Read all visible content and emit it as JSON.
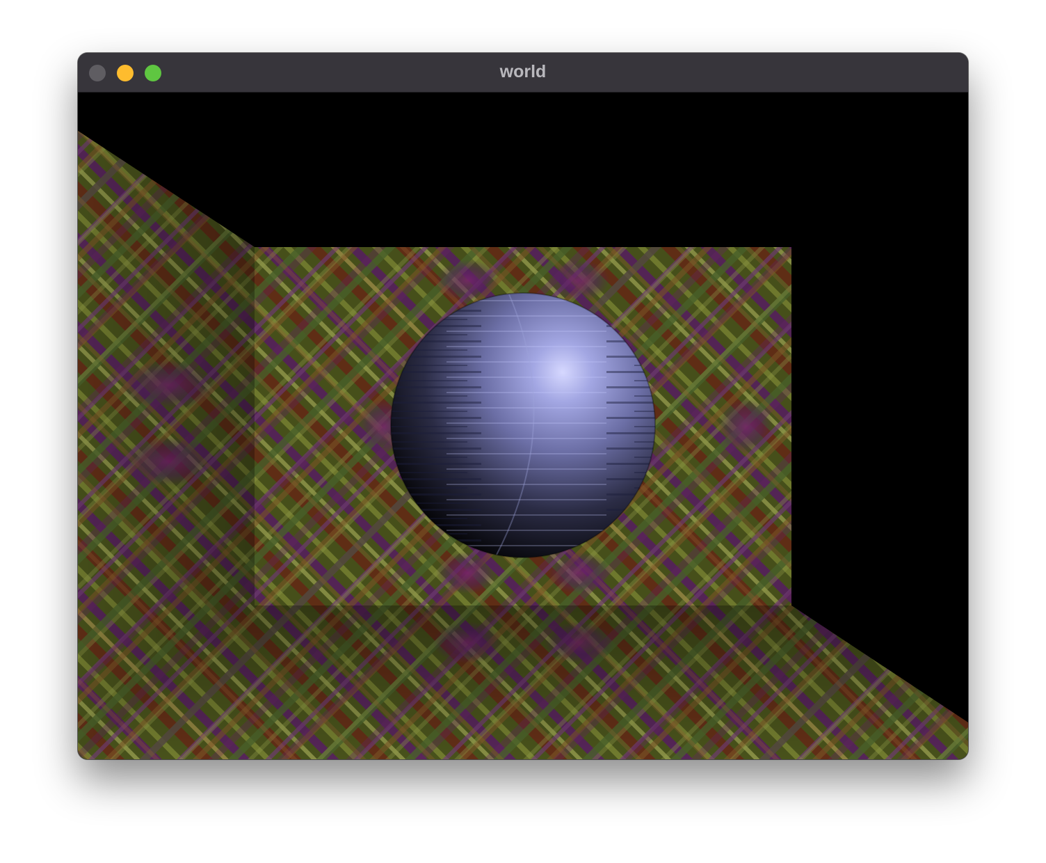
{
  "window": {
    "title": "world",
    "controls": {
      "close_color": "#5f5d62",
      "minimize_color": "#febc2e",
      "maximize_color": "#5fc641"
    }
  },
  "scene": {
    "background_color": "#000000",
    "objects": [
      {
        "name": "left-wall",
        "texture": "kaleidoscope-pattern"
      },
      {
        "name": "back-wall",
        "texture": "kaleidoscope-pattern"
      },
      {
        "name": "floor",
        "texture": "kaleidoscope-pattern"
      },
      {
        "name": "sphere",
        "color": "#8a8ed0",
        "texture": "streaked-metal"
      }
    ]
  }
}
